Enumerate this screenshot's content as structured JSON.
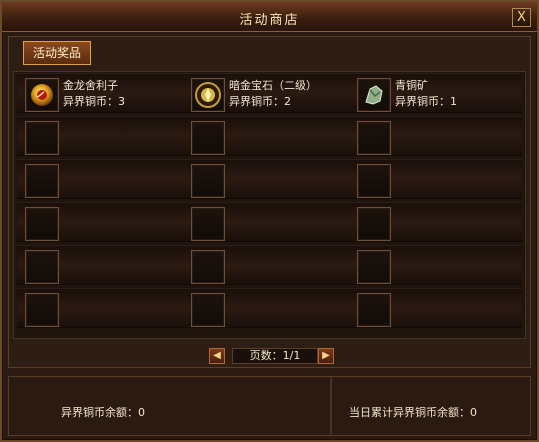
{
  "window": {
    "title": "活动商店",
    "close_label": "X"
  },
  "tabs": [
    {
      "label": "活动奖品"
    }
  ],
  "items": [
    {
      "name": "金龙舍利子",
      "price": "异界铜币：3",
      "icon": "gold-dragon-relic-icon"
    },
    {
      "name": "暗金宝石（二级）",
      "price": "异界铜币：2",
      "icon": "dark-gold-gem-icon"
    },
    {
      "name": "青铜矿",
      "price": "异界铜币：1",
      "icon": "bronze-ore-icon"
    }
  ],
  "pager": {
    "info": "页数：1/1",
    "prev": "◀",
    "next": "▶"
  },
  "footer": {
    "balance": "异界铜币余额：0",
    "daily": "当日累计异界铜币余额：0"
  },
  "colors": {
    "accent": "#e3a24a",
    "text": "#f1e7d0"
  }
}
